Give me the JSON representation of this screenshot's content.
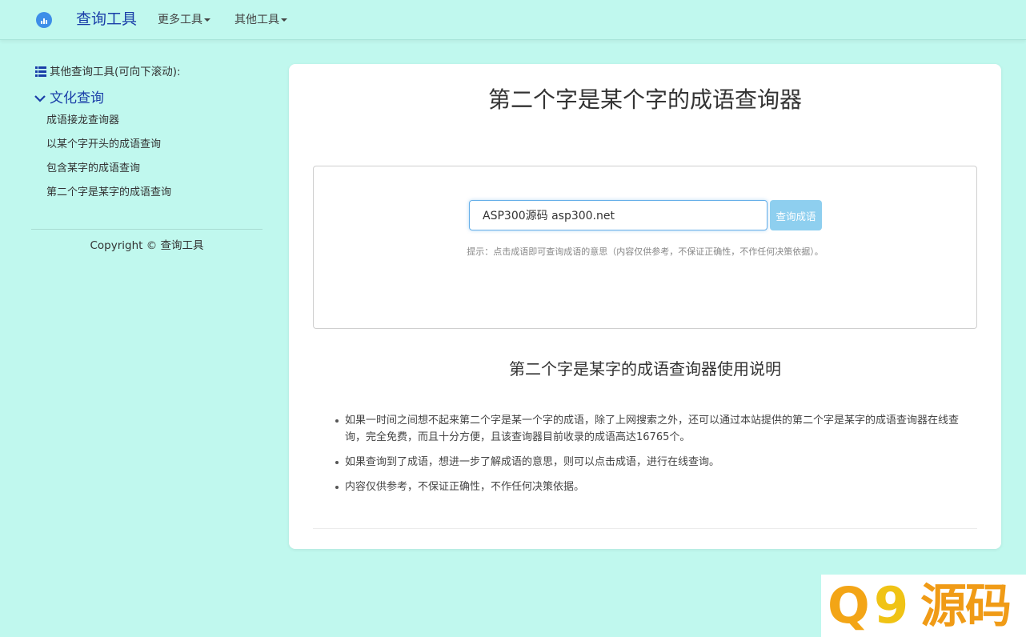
{
  "navbar": {
    "brand": "查询工具",
    "menu_more": "更多工具",
    "menu_other": "其他工具"
  },
  "sidebar": {
    "heading": "其他查询工具(可向下滚动):",
    "category": "文化查询",
    "links": [
      "成语接龙查询器",
      "以某个字开头的成语查询",
      "包含某字的成语查询",
      "第二个字是某字的成语查询"
    ],
    "copyright": "Copyright © 查询工具"
  },
  "main": {
    "title": "第二个字是某个字的成语查询器",
    "search": {
      "value": "ASP300源码 asp300.net",
      "button": "查询成语",
      "hint": "提示：点击成语即可查询成语的意思（内容仅供参考，不保证正确性，不作任何决策依据）。"
    },
    "usage_title": "第二个字是某字的成语查询器使用说明",
    "notes": [
      "如果一时间之间想不起来第二个字是某一个字的成语，除了上网搜索之外，还可以通过本站提供的第二个字是某字的成语查询器在线查询，完全免费，而且十分方便，且该查询器目前收录的成语高达16765个。",
      "如果查询到了成语，想进一步了解成语的意思，则可以点击成语，进行在线查询。",
      "内容仅供参考，不保证正确性，不作任何决策依据。"
    ]
  },
  "watermark": {
    "q": "Q",
    "nine": "9",
    "text": "源码"
  },
  "colors": {
    "background": "#c0f8ee",
    "brand": "#1a3ea8",
    "button": "#8ecfef",
    "watermark_orange": "#f3a516"
  },
  "icons": {
    "logo": "chart-logo-icon",
    "list": "list-icon",
    "chevron": "chevron-down-icon"
  }
}
